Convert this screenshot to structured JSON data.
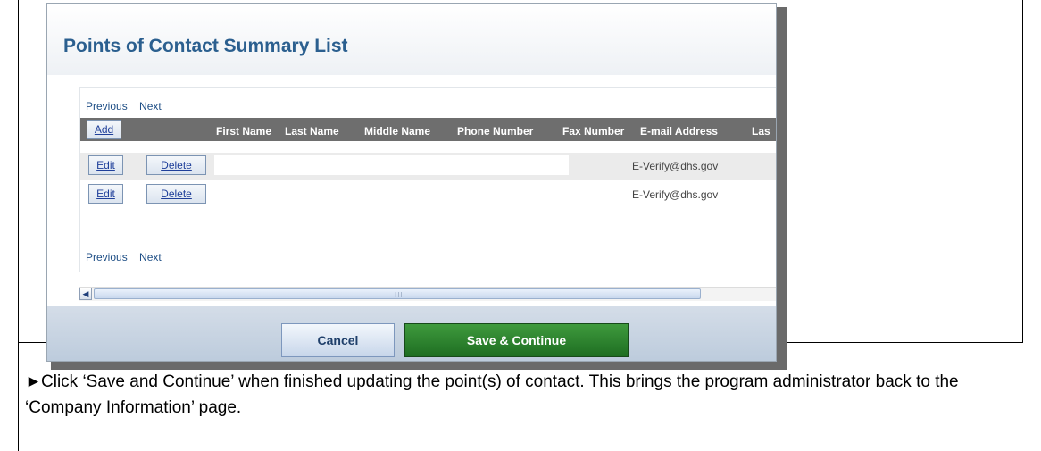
{
  "screen": {
    "title": "Points of Contact Summary List",
    "pager": {
      "previous": "Previous",
      "next": "Next"
    },
    "table": {
      "add_label": "Add",
      "columns": [
        "First Name",
        "Last Name",
        "Middle Name",
        "Phone Number",
        "Fax Number",
        "E-mail Address",
        "Las"
      ],
      "rows": [
        {
          "edit_label": "Edit",
          "delete_label": "Delete",
          "email": "E-Verify@dhs.gov"
        },
        {
          "edit_label": "Edit",
          "delete_label": "Delete",
          "email": "E-Verify@dhs.gov"
        }
      ]
    },
    "buttons": {
      "cancel": "Cancel",
      "save": "Save & Continue"
    }
  },
  "instruction": {
    "arrow": "►",
    "text": "Click ‘Save and Continue’ when finished updating the point(s) of contact. This brings the program administrator back to the ‘Company Information’ page."
  },
  "icons": {
    "scroll_left": "◀"
  }
}
